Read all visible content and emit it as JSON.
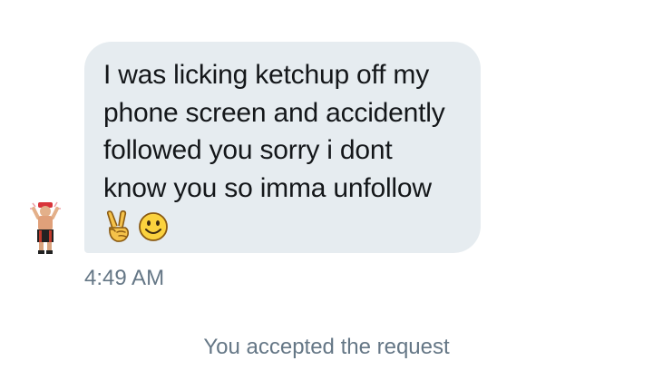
{
  "message": {
    "text": "I was licking ketchup off my\nphone screen and accidently\nfollowed you sorry i dont\nknow you so imma unfollow",
    "emojis": [
      "victory-hand-emoji",
      "smiling-face-emoji"
    ],
    "timestamp": "4:49 AM"
  },
  "system": {
    "notice": "You accepted the request"
  },
  "colors": {
    "bubble": "#e6ecf0",
    "text": "#14171a",
    "meta": "#657786"
  }
}
